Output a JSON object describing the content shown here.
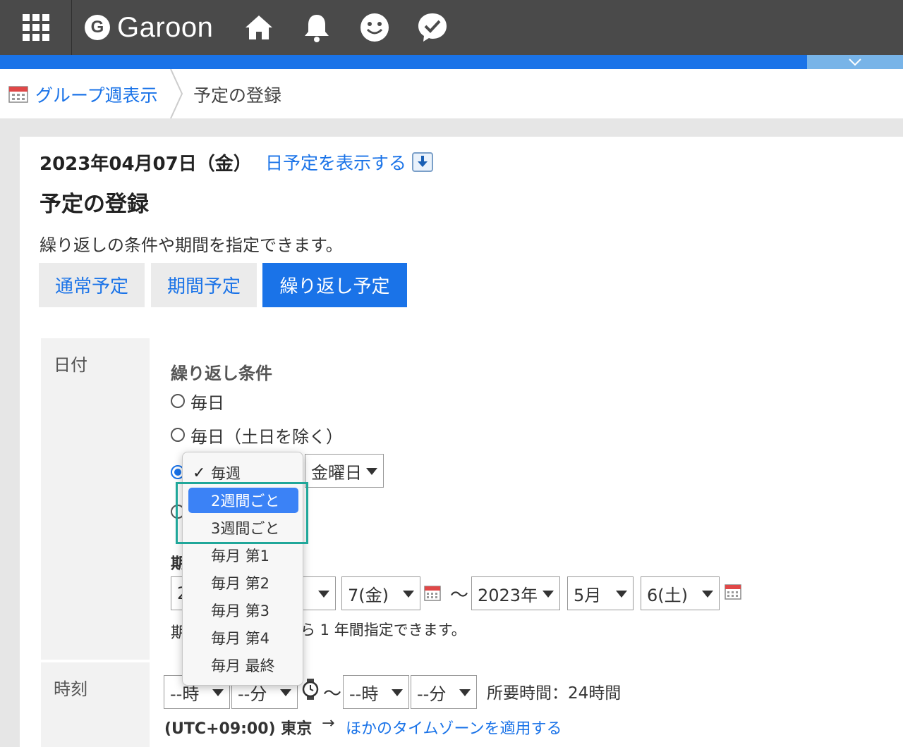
{
  "app": {
    "name": "Garoon",
    "logo_letter": "G",
    "accent_color": "#1a73e8",
    "highlight_box_color": "#20a79a"
  },
  "topbar": {
    "icons": [
      "apps-grid-icon",
      "home-icon",
      "bell-icon",
      "smiley-icon",
      "chat-check-icon"
    ]
  },
  "breadcrumb": {
    "parent_label": "グループ週表示",
    "current_label": "予定の登録"
  },
  "header": {
    "date": "2023年04月07日（金）",
    "day_link": "日予定を表示する",
    "title": "予定の登録",
    "description": "繰り返しの条件や期間を指定できます。"
  },
  "tabs": [
    {
      "label": "通常予定",
      "active": false
    },
    {
      "label": "期間予定",
      "active": false
    },
    {
      "label": "繰り返し予定",
      "active": true
    }
  ],
  "date_section": {
    "label": "日付",
    "repeat_label": "繰り返し条件",
    "options": {
      "daily": "毎日",
      "weekdays": "毎日（土日を除く）"
    },
    "weekday_select": "金曜日",
    "period_label_partial": "期",
    "start": {
      "year_partial": "2",
      "day": "7(金)"
    },
    "end": {
      "year": "2023年",
      "month": "5月",
      "day": "6(土)"
    },
    "period_hint_prefix": "期",
    "period_hint": "ら 1 年間指定できます。"
  },
  "time_section": {
    "label": "時刻",
    "start_hour": "--時",
    "start_min": "--分",
    "end_hour": "--時",
    "end_min": "--分",
    "tilde": "〜",
    "duration": "所要時間：24時間",
    "timezone": "(UTC+09:00) 東京",
    "tz_arrow": "→",
    "tz_link": "ほかのタイムゾーンを適用する"
  },
  "dropdown": {
    "items": [
      {
        "label": "毎週",
        "checked": true,
        "highlighted": false
      },
      {
        "label": "2週間ごと",
        "checked": false,
        "highlighted": true
      },
      {
        "label": "3週間ごと",
        "checked": false,
        "highlighted": false
      },
      {
        "label": "毎月 第1",
        "checked": false,
        "highlighted": false
      },
      {
        "label": "毎月 第2",
        "checked": false,
        "highlighted": false
      },
      {
        "label": "毎月 第3",
        "checked": false,
        "highlighted": false
      },
      {
        "label": "毎月 第4",
        "checked": false,
        "highlighted": false
      },
      {
        "label": "毎月 最終",
        "checked": false,
        "highlighted": false
      }
    ]
  }
}
